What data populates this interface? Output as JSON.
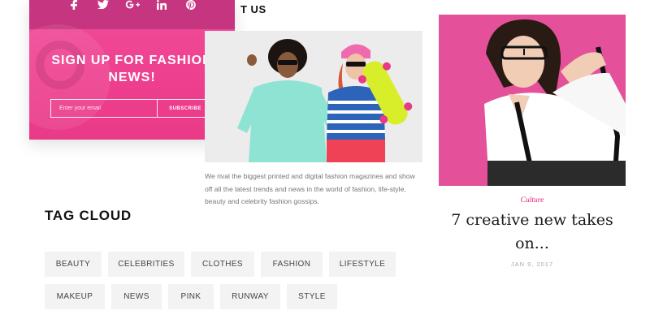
{
  "newsletter": {
    "social_icons": [
      {
        "icon": "facebook-icon",
        "glyph": "f"
      },
      {
        "icon": "twitter-icon",
        "glyph": ""
      },
      {
        "icon": "google-plus-icon",
        "glyph": "G+"
      },
      {
        "icon": "linkedin-icon",
        "glyph": "in"
      },
      {
        "icon": "pinterest-icon",
        "glyph": ""
      }
    ],
    "title": "SIGN UP FOR FASHION NEWS!",
    "email_placeholder": "Enter your email",
    "subscribe_label": "SUBSCRIBE",
    "colors": {
      "card": "#ee3f8e",
      "strip": "#c6357f"
    }
  },
  "about": {
    "heading_visible": "T US",
    "text": "We rival the biggest printed and digital fashion magazines and show off all the latest trends and news in the world of fashion, life-style, beauty and celebrity fashion gossips."
  },
  "tag_cloud": {
    "title": "TAG CLOUD",
    "tags": [
      "BEAUTY",
      "CELEBRITIES",
      "CLOTHES",
      "FASHION",
      "LIFESTYLE",
      "MAKEUP",
      "NEWS",
      "PINK",
      "RUNWAY",
      "STYLE"
    ]
  },
  "post": {
    "category": "Culture",
    "title": "7 creative new takes on...",
    "date": "JAN 9, 2017",
    "accent_color": "#e21c7a"
  }
}
